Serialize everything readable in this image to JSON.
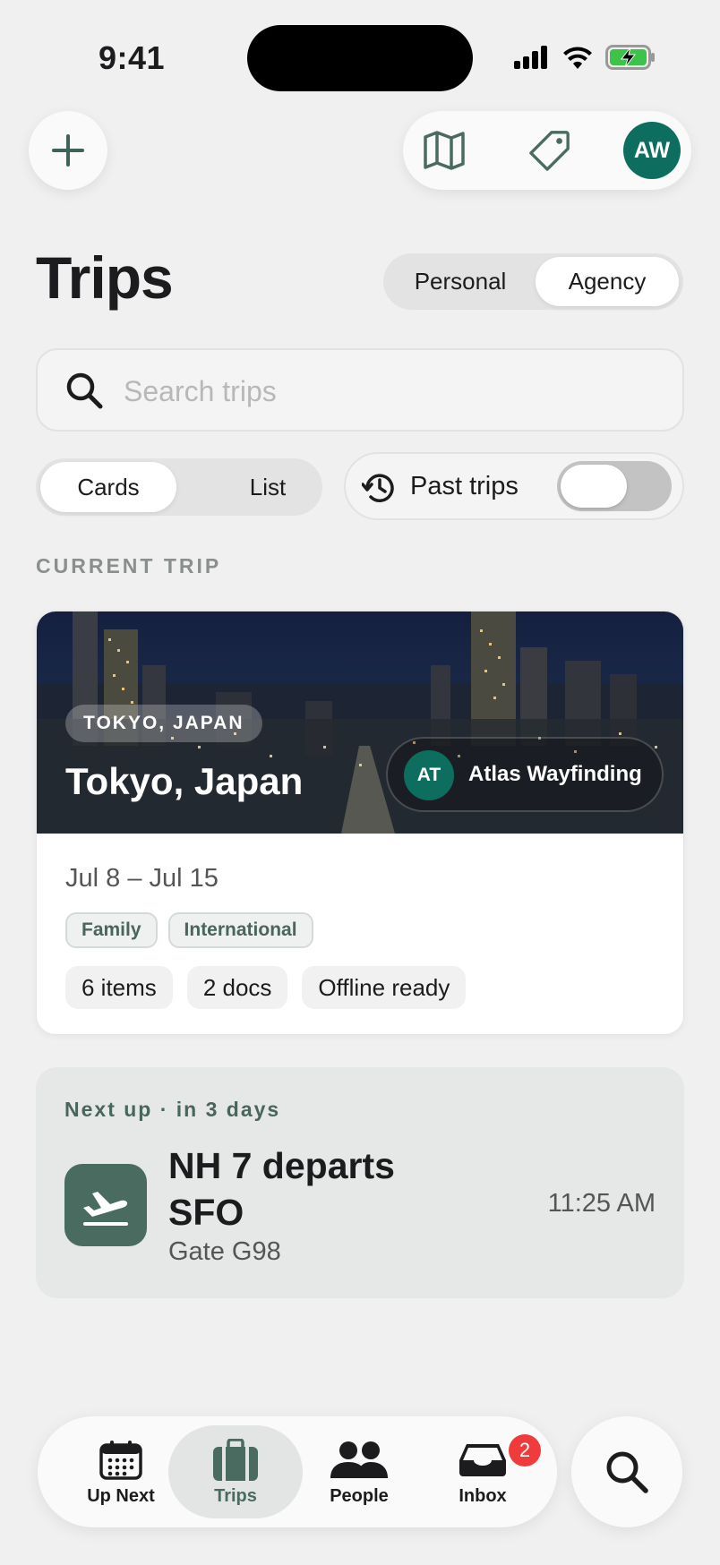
{
  "status_bar": {
    "time": "9:41"
  },
  "header": {
    "add_icon": "plus-icon",
    "map_icon": "map-icon",
    "tag_icon": "tag-icon",
    "avatar_initials": "AW"
  },
  "page": {
    "title": "Trips",
    "mode_options": [
      "Personal",
      "Agency"
    ],
    "mode_selected": "Agency"
  },
  "search": {
    "placeholder": "Search trips"
  },
  "view": {
    "options": [
      "Cards",
      "List"
    ],
    "selected": "Cards",
    "past_trips_label": "Past trips",
    "past_trips_on": false
  },
  "current_trip": {
    "section_label": "CURRENT TRIP",
    "location_badge": "TOKYO, JAPAN",
    "title": "Tokyo, Japan",
    "agency_initials": "AT",
    "agency_name": "Atlas Wayfinding",
    "dates": "Jul 8 – Jul 15",
    "tags": [
      "Family",
      "International"
    ],
    "meta": [
      "6 items",
      "2 docs",
      "Offline ready"
    ]
  },
  "next_up": {
    "label": "Next up · in 3 days",
    "title": "NH 7 departs SFO",
    "subtitle": "Gate G98",
    "time": "11:25 AM"
  },
  "tabbar": {
    "items": [
      {
        "label": "Up Next",
        "icon": "calendar-icon"
      },
      {
        "label": "Trips",
        "icon": "suitcase-icon"
      },
      {
        "label": "People",
        "icon": "people-icon"
      },
      {
        "label": "Inbox",
        "icon": "inbox-icon",
        "badge": "2"
      }
    ],
    "active": "Trips"
  },
  "colors": {
    "accent": "#0d6e5f",
    "muted_green": "#4a6b60",
    "badge_red": "#ef3b3b",
    "background": "#f0f0f0"
  }
}
